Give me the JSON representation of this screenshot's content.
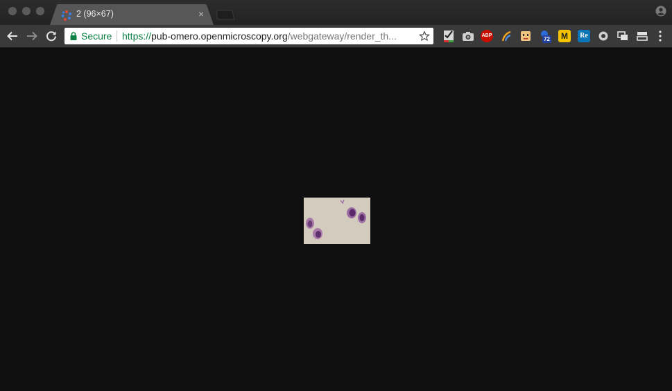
{
  "window": {
    "tab": {
      "title": "2 (96×67)",
      "close_symbol": "×",
      "favicon": "omero-icon"
    }
  },
  "toolbar": {
    "security_label": "Secure",
    "url": {
      "scheme": "https://",
      "host": "pub-omero.openmicroscopy.org",
      "path": "/webgateway/render_th..."
    }
  },
  "extensions": [
    {
      "name": "checklist-extension-icon"
    },
    {
      "name": "camera-extension-icon"
    },
    {
      "name": "adblock-plus-icon",
      "label": "ABP"
    },
    {
      "name": "feed-extension-icon"
    },
    {
      "name": "face-extension-icon"
    },
    {
      "name": "badge-extension-icon",
      "badge": "72"
    },
    {
      "name": "m-extension-icon",
      "label": "M"
    },
    {
      "name": "re-extension-icon",
      "label": "Re"
    },
    {
      "name": "record-extension-icon"
    },
    {
      "name": "windows-extension-icon"
    },
    {
      "name": "layout-extension-icon"
    }
  ],
  "content": {
    "image_alt": "microscopy thumbnail",
    "image_dimensions": "96×67"
  },
  "colors": {
    "page_background": "#0f0f0f",
    "secure_green": "#0b8043",
    "abp_red": "#c70d00",
    "m_yellow": "#f5c400",
    "re_blue": "#0a76b7"
  }
}
